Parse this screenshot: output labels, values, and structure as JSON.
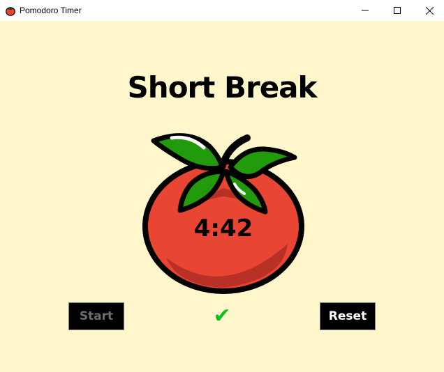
{
  "window": {
    "title": "Pomodoro Timer",
    "icon": "tomato-icon",
    "controls": [
      "minimize-icon",
      "maximize-icon",
      "close-icon"
    ]
  },
  "main": {
    "heading": "Short Break",
    "timer": "4:42",
    "checkmarks": "✔"
  },
  "buttons": {
    "start_label": "Start",
    "reset_label": "Reset"
  },
  "colors": {
    "background": "#fff6cb",
    "tomato_red": "#e84632",
    "leaf_green": "#219a0b",
    "check_green": "#10c020",
    "button_bg": "#000000",
    "start_text": "#6d6d6d",
    "reset_text": "#ffffff"
  }
}
